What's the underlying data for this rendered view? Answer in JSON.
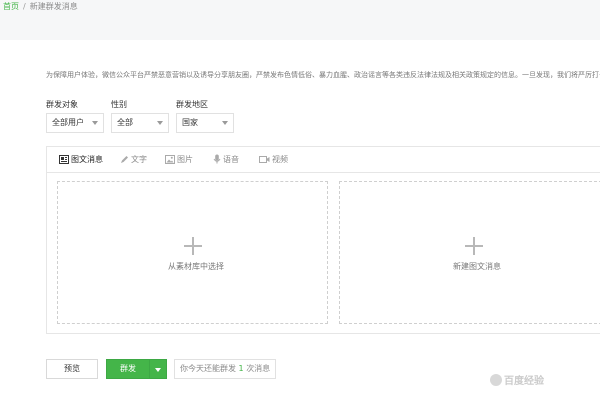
{
  "breadcrumb": {
    "home": "首页",
    "separator": "/",
    "current": "新建群发消息"
  },
  "notice": "为保障用户体验，微信公众平台严禁恶意营销以及诱导分享朋友圈，严禁发布色情低俗、暴力血腥、政治谣言等各类违反法律法规及相关政策规定的信息。一旦发现，我们将严厉打击和处理。",
  "filters": {
    "target": {
      "label": "群发对象",
      "value": "全部用户"
    },
    "gender": {
      "label": "性别",
      "value": "全部"
    },
    "region": {
      "label": "群发地区",
      "value": "国家"
    }
  },
  "tabs": [
    {
      "label": "图文消息",
      "icon": "article-icon",
      "active": true
    },
    {
      "label": "文字",
      "icon": "pen-icon"
    },
    {
      "label": "图片",
      "icon": "image-icon"
    },
    {
      "label": "语音",
      "icon": "microphone-icon"
    },
    {
      "label": "视频",
      "icon": "video-icon"
    }
  ],
  "cards": {
    "library": {
      "label": "从素材库中选择"
    },
    "new": {
      "label": "新建图文消息"
    }
  },
  "actions": {
    "preview": "预览",
    "send": "群发",
    "quota_prefix": "你今天还能群发",
    "quota_count": "1",
    "quota_suffix": "次消息"
  },
  "watermark": "百度经验",
  "colors": {
    "accent": "#44b549",
    "background": "#f6f7f8"
  }
}
